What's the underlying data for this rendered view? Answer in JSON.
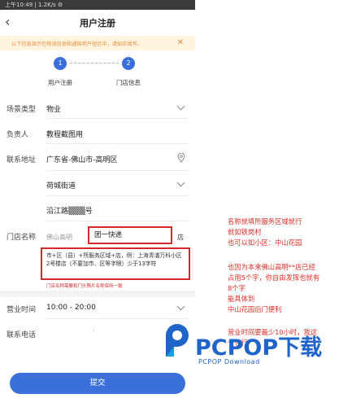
{
  "statusbar": {
    "text": "上午10:49 | 1.2K/s ⚙"
  },
  "nav": {
    "title": "用户注册"
  },
  "notice": {
    "text": "以下信息显示在物流信息和通知用户短信中，请如实填写。",
    "close": "✕"
  },
  "steps": [
    {
      "number": "1",
      "label": "用户注册"
    },
    {
      "number": "2",
      "label": "门店信息"
    }
  ],
  "form": {
    "scene_type": {
      "label": "场景类型",
      "value": "物业"
    },
    "owner": {
      "label": "负责人",
      "value": "教程截图用"
    },
    "address": {
      "label": "联系地址",
      "region": "广东省-佛山市-高明区",
      "street": "荷城街道",
      "road": "沿江路▒▒▒号"
    },
    "shop_name": {
      "label": "门店名称",
      "prefix": "佛山高明",
      "value": "团一快递",
      "suffix": "店"
    },
    "hint": "市+区（县）+所服务区域+店，例：上海青浦万科小区2号楼店（不要加市、区等字眼）少于13字符",
    "hint_red": "门店名称需要和门头照片名称保持一致",
    "business_hours": {
      "label": "营业时间",
      "value": "10:00 - 20:00"
    },
    "phone": {
      "label": "联系电话",
      "value": ""
    }
  },
  "submit_label": "提交",
  "annotations": [
    "名称就填所服务区域就行",
    "就如铁岗村",
    "也可以如小区：中山花园",
    "",
    "也因为本来佛山高明**店已经",
    "占用5个字，你自由发挥也就有",
    "8个字",
    "能具体到",
    "中山花园后门便利",
    "",
    "营业时间要最少10小时，我这",
    "个也行"
  ],
  "watermark": {
    "brand": "PCPOP下载",
    "sub": "PCPOP Download"
  },
  "colors": {
    "primary": "#3b6fd9",
    "annotation": "#e0302a",
    "notice_bg": "#fff4e0",
    "notice_text": "#e8903a"
  }
}
